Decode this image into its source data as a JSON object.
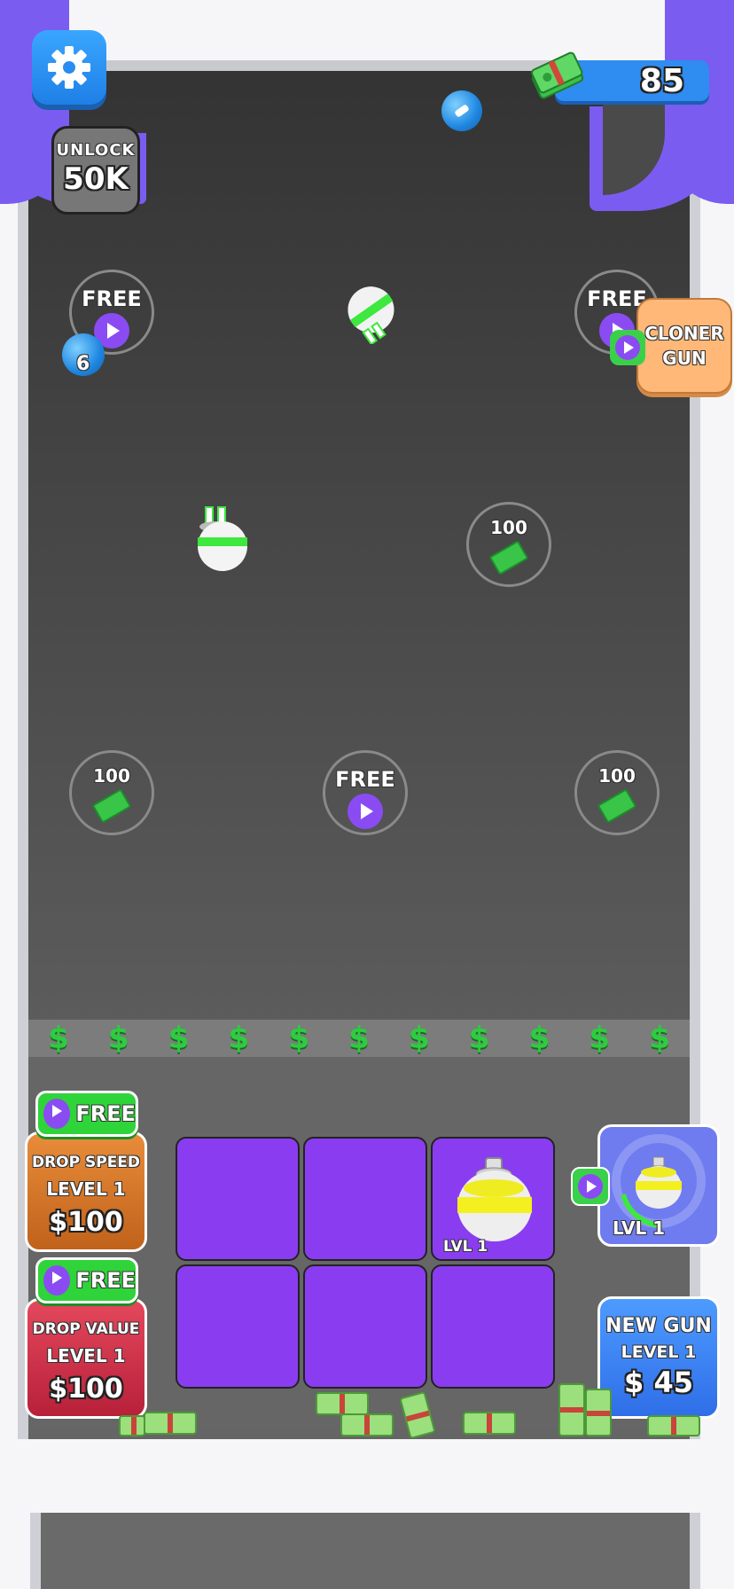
{
  "hud": {
    "money": "85",
    "unlock_label": "UNLOCK",
    "unlock_value": "50K"
  },
  "slots": [
    {
      "id": "slot-top-left",
      "type": "free",
      "label": "FREE"
    },
    {
      "id": "slot-top-right",
      "type": "free",
      "label": "FREE"
    },
    {
      "id": "slot-mid-right",
      "type": "cost",
      "label": "100"
    },
    {
      "id": "slot-low-left",
      "type": "cost",
      "label": "100"
    },
    {
      "id": "slot-low-center",
      "type": "free",
      "label": "FREE"
    },
    {
      "id": "slot-low-right",
      "type": "cost",
      "label": "100"
    }
  ],
  "ball_value": "6",
  "cloner": {
    "label_line1": "CLONER",
    "label_line2": "GUN"
  },
  "dollar_strip": [
    "$",
    "$",
    "$",
    "$",
    "$",
    "$",
    "$",
    "$",
    "$",
    "$",
    "$"
  ],
  "upgrades": {
    "drop_speed": {
      "free_label": "FREE",
      "title": "DROP SPEED",
      "level": "LEVEL 1",
      "price": "$100"
    },
    "drop_value": {
      "free_label": "FREE",
      "title": "DROP VALUE",
      "level": "LEVEL 1",
      "price": "$100"
    }
  },
  "grid": {
    "cell_level": "LVL 1"
  },
  "gun_preview": {
    "level": "LVL 1"
  },
  "new_gun": {
    "title": "NEW GUN",
    "level": "LEVEL 1",
    "price": "$ 45"
  },
  "colors": {
    "accent_purple": "#7b5cf0",
    "cell_purple": "#8a3df0",
    "free_green": "#2fd43a",
    "money_blue": "#2f8cf0"
  }
}
